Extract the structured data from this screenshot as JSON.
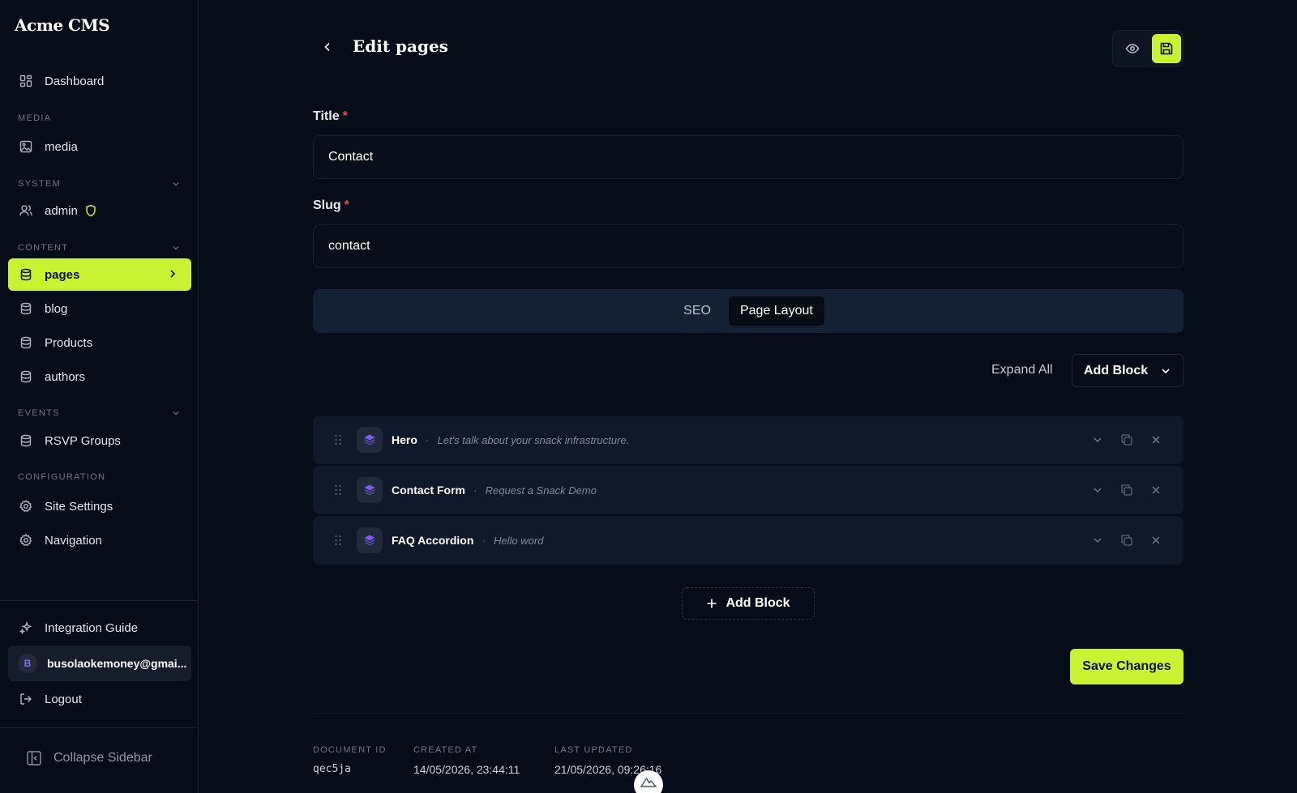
{
  "sidebar": {
    "brand": "Acme CMS",
    "dashboard": "Dashboard",
    "sections": {
      "media": "MEDIA",
      "system": "SYSTEM",
      "content": "CONTENT",
      "events": "EVENTS",
      "configuration": "CONFIGURATION"
    },
    "items": {
      "media": "media",
      "admin": "admin",
      "pages": "pages",
      "blog": "blog",
      "products": "Products",
      "authors": "authors",
      "rsvp": "RSVP Groups",
      "site_settings": "Site Settings",
      "navigation": "Navigation"
    },
    "integration_guide": "Integration Guide",
    "user_initial": "B",
    "user_email": "busolaokemoney@gmai...",
    "logout": "Logout",
    "collapse": "Collapse Sidebar"
  },
  "header": {
    "title": "Edit pages"
  },
  "form": {
    "title_label": "Title",
    "title_value": "Contact",
    "slug_label": "Slug",
    "slug_value": "contact",
    "required_mark": "*"
  },
  "tabs": [
    {
      "label": "SEO",
      "active": false
    },
    {
      "label": "Page Layout",
      "active": true
    }
  ],
  "blocks_toolbar": {
    "expand_all": "Expand All",
    "add_block": "Add Block"
  },
  "blocks": [
    {
      "name": "Hero",
      "desc": "Let's talk about your snack infrastructure."
    },
    {
      "name": "Contact Form",
      "desc": "Request a Snack Demo"
    },
    {
      "name": "FAQ Accordion",
      "desc": "Hello word"
    }
  ],
  "separator": "·",
  "add_block_button": "Add Block",
  "save_button": "Save Changes",
  "meta": {
    "doc_id_label": "DOCUMENT ID",
    "doc_id": "qec5ja",
    "created_label": "CREATED AT",
    "created": "14/05/2026, 23:44:11",
    "updated_label": "LAST UPDATED",
    "updated": "21/05/2026, 09:26:16"
  },
  "colors": {
    "accent": "#c8f232",
    "background": "#070d18",
    "panel": "#0f1929",
    "required": "#e8484a",
    "block_icon": "#7c5cf5"
  }
}
